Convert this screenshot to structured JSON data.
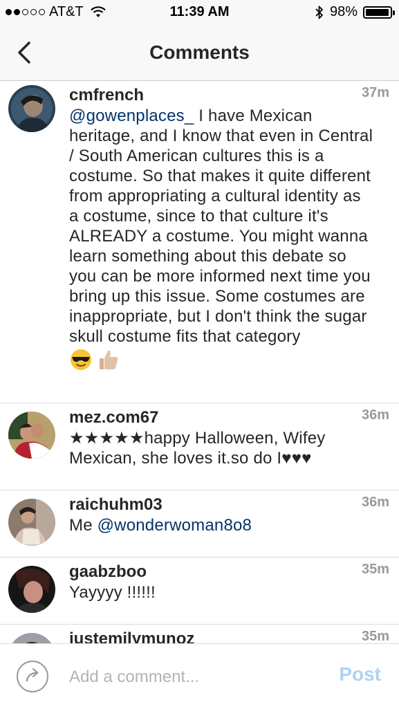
{
  "status_bar": {
    "carrier": "AT&T",
    "signal_bars_filled": 2,
    "signal_bars_total": 5,
    "time": "11:39 AM",
    "battery_percent": "98%",
    "battery_level": 0.98
  },
  "nav": {
    "title": "Comments",
    "back_icon": "chevron-left-icon"
  },
  "comments": [
    {
      "username": "cmfrench",
      "time": "37m",
      "mention": "@gowenplaces_",
      "text": " I have Mexican heritage, and I know that even in Central / South American cultures this is a costume. So that makes it quite different from appropriating a cultural identity as a costume, since to that culture it's ALREADY a costume. You might wanna learn something about this debate so you can be more informed next time you bring up this issue. Some costumes are inappropriate, but I don't think the sugar skull costume fits that category",
      "emojis": [
        "sunglasses-emoji",
        "thumbs-up-emoji"
      ]
    },
    {
      "username": "mez.com67",
      "time": "36m",
      "text": "★★★★★happy Halloween, Wifey Mexican, she loves it.so do I♥♥♥"
    },
    {
      "username": "raichuhm03",
      "time": "36m",
      "text_prefix": "Me ",
      "mention": "@wonderwoman8o8"
    },
    {
      "username": "gaabzboo",
      "time": "35m",
      "text": "Yayyyy !!!!!!"
    },
    {
      "username": "justemilymunoz",
      "time": "35m"
    }
  ],
  "composer": {
    "placeholder": "Add a comment...",
    "post_label": "Post",
    "reply_icon": "reply-arrow-icon"
  },
  "colors": {
    "mention": "#003569",
    "post_disabled": "#aed2f5",
    "timestamp": "#999999"
  }
}
